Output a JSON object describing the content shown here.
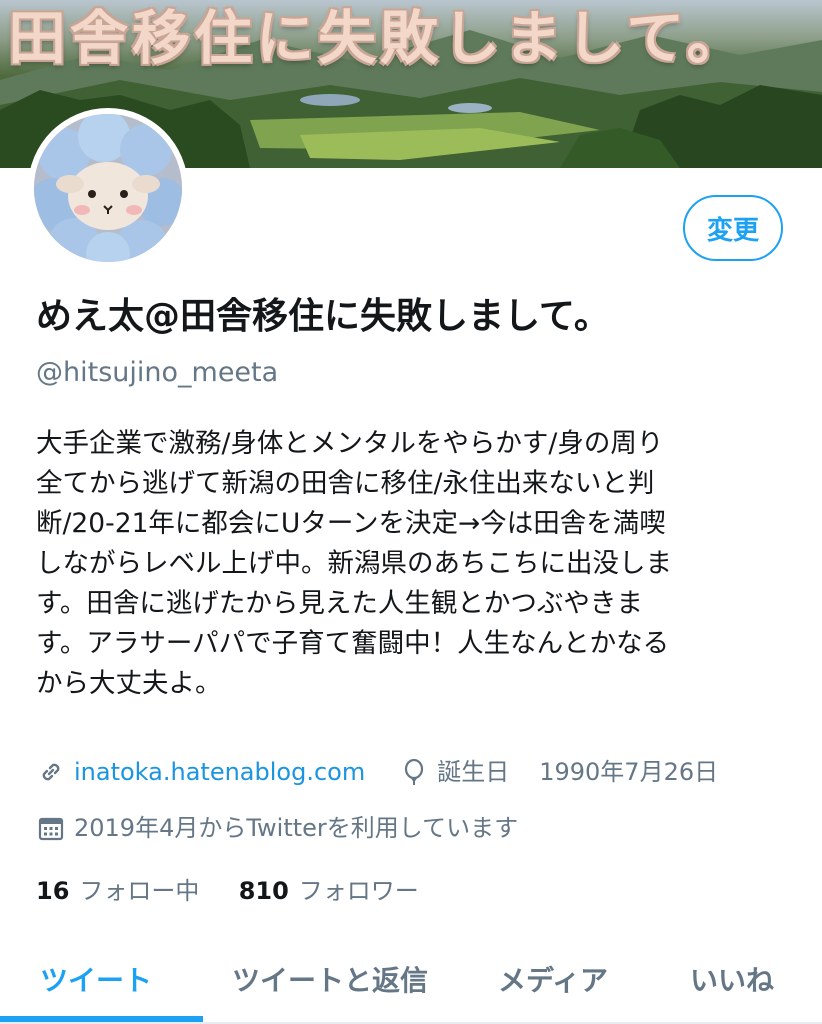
{
  "banner": {
    "title": "田舎移住に失敗しまして。"
  },
  "header": {
    "edit_label": "変更"
  },
  "profile": {
    "name": "めえ太@田舎移住に失敗しまして。",
    "handle": "@hitsujino_meeta",
    "bio_lines": [
      "大手企業で激務/身体とメンタルをやらかす/身の周り",
      "全てから逃げて新潟の田舎に移住/永住出来ないと判",
      "断/20-21年に都会にUターンを決定→今は田舎を満喫",
      "しながらレベル上げ中。新潟県のあちこちに出没しま",
      "す。田舎に逃げたから見えた人生観とかつぶやきま",
      "す。アラサーパパで子育て奮闘中！人生なんとかなる",
      "から大丈夫よ。"
    ],
    "website": "inatoka.hatenablog.com",
    "birthday_label": "誕生日",
    "birthday": "1990年7月26日",
    "joined": "2019年4月からTwitterを利用しています",
    "following_count": "16",
    "following_label": "フォロー中",
    "followers_count": "810",
    "followers_label": "フォロワー"
  },
  "tabs": [
    {
      "label": "ツイート",
      "active": true
    },
    {
      "label": "ツイートと返信",
      "active": false
    },
    {
      "label": "メディア",
      "active": false
    },
    {
      "label": "いいね",
      "active": false
    }
  ],
  "colors": {
    "accent": "#1da1f2",
    "link": "#1b95e0",
    "muted": "#657786",
    "text": "#14171a"
  }
}
